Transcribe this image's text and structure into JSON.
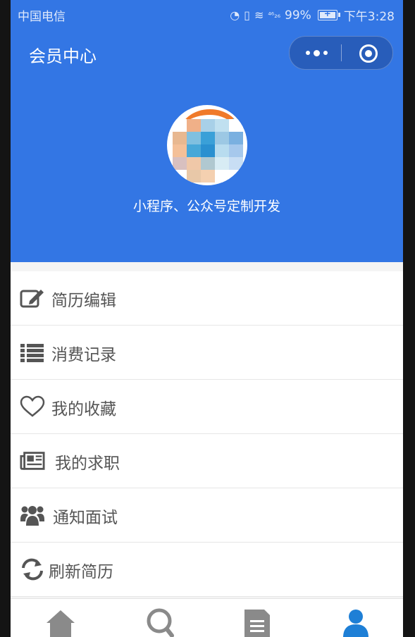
{
  "status_bar": {
    "carrier": "中国电信",
    "signal_text": "⁴⁶₂₆",
    "battery_percent": "99%",
    "battery_level": 0.99,
    "time": "下午3:28"
  },
  "navbar": {
    "title": "会员中心"
  },
  "profile": {
    "name": "小程序、公众号定制开发"
  },
  "menu": [
    {
      "label": "简历编辑",
      "icon": "edit-icon"
    },
    {
      "label": "消费记录",
      "icon": "list-icon"
    },
    {
      "label": "我的收藏",
      "icon": "heart-icon"
    },
    {
      "label": "我的求职",
      "icon": "newspaper-icon"
    },
    {
      "label": "通知面试",
      "icon": "users-icon"
    },
    {
      "label": "刷新简历",
      "icon": "refresh-icon"
    }
  ],
  "tabbar": {
    "items": [
      {
        "icon": "home-icon",
        "active": false
      },
      {
        "icon": "search-icon",
        "active": false
      },
      {
        "icon": "document-icon",
        "active": false
      },
      {
        "icon": "user-icon",
        "active": true
      }
    ],
    "active_color": "#1e7fd6",
    "inactive_color": "#8a8a8a"
  },
  "colors": {
    "header_blue": "#3376e4"
  }
}
